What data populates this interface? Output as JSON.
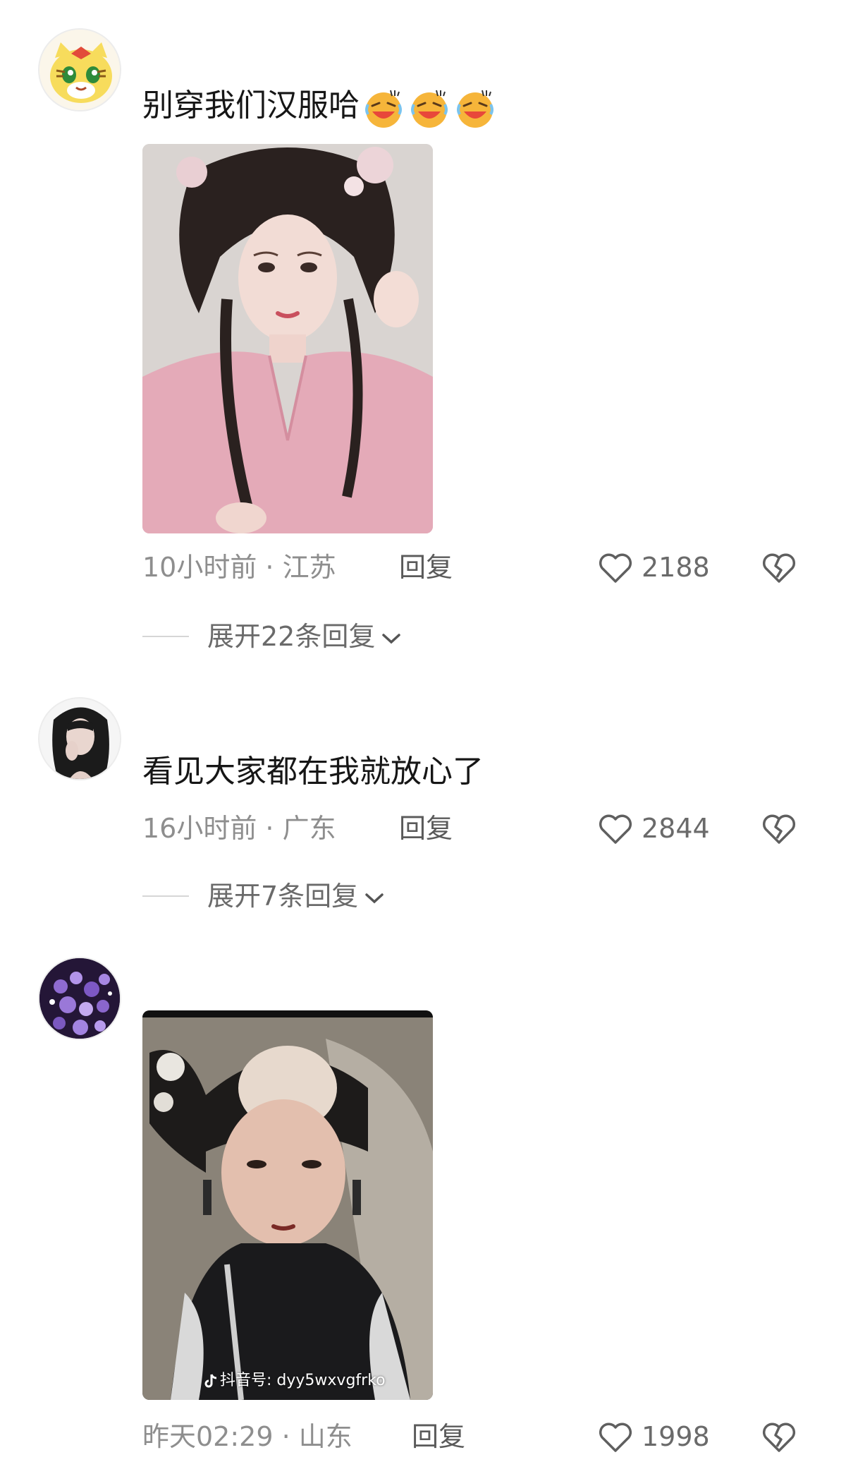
{
  "comments": [
    {
      "avatar": "tiger-cartoon-avatar",
      "text": "别穿我们汉服哈",
      "emoji": "laughing-tears-emoji",
      "emoji_count": 3,
      "photo": "woman-in-pink-hanfu-photo",
      "time": "10小时前 · 江苏",
      "reply_label": "回复",
      "likes": "2188",
      "expand_label": "展开22条回复"
    },
    {
      "avatar": "woman-portrait-avatar",
      "text": "看见大家都在我就放心了",
      "time": "16小时前 · 广东",
      "reply_label": "回复",
      "likes": "2844",
      "expand_label": "展开7条回复"
    },
    {
      "avatar": "purple-flowers-avatar",
      "photo": "qing-dynasty-woman-photo",
      "watermark_prefix": "抖音号:",
      "watermark_id": "dyy5wxvgfrko",
      "time": "昨天02:29 · 山东",
      "reply_label": "回复",
      "likes": "1998"
    }
  ],
  "colors": {
    "meta_text": "#8e8e8e",
    "reply_text": "#5a5a5a",
    "body_text": "#161616",
    "icon_stroke": "#5f5f5f"
  }
}
